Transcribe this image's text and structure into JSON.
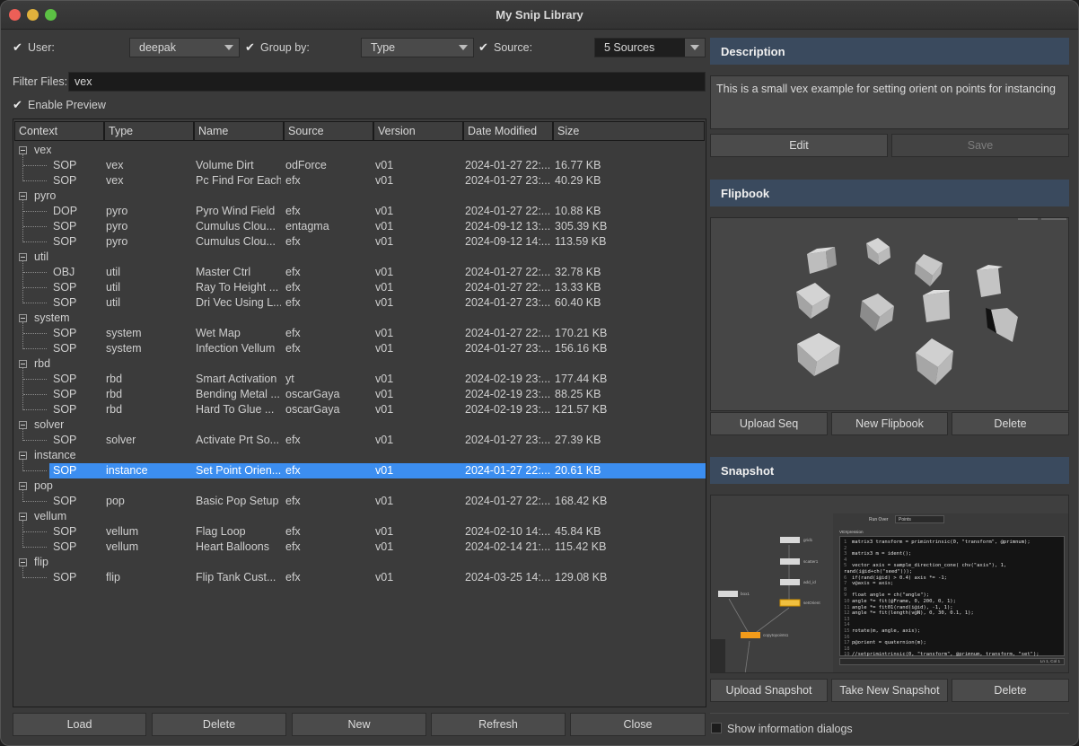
{
  "window": {
    "title": "My Snip Library"
  },
  "filters": {
    "user_label": "User:",
    "user_value": "deepak",
    "groupby_label": "Group by:",
    "groupby_value": "Type",
    "source_label": "Source:",
    "source_value": "5 Sources",
    "filter_label": "Filter Files:",
    "filter_value": "vex",
    "enable_preview_label": "Enable Preview"
  },
  "table": {
    "columns": [
      "Context",
      "Type",
      "Name",
      "Source",
      "Version",
      "Date Modified",
      "Size"
    ],
    "groups": [
      {
        "name": "vex",
        "rows": [
          [
            "SOP",
            "vex",
            "Volume Dirt",
            "odForce",
            "v01",
            "2024-01-27 22:...",
            "16.77 KB"
          ],
          [
            "SOP",
            "vex",
            "Pc Find For Each",
            "efx",
            "v01",
            "2024-01-27 23:...",
            "40.29 KB"
          ]
        ]
      },
      {
        "name": "pyro",
        "rows": [
          [
            "DOP",
            "pyro",
            "Pyro Wind Field",
            "efx",
            "v01",
            "2024-01-27 22:...",
            "10.88 KB"
          ],
          [
            "SOP",
            "pyro",
            "Cumulus Clou...",
            "entagma",
            "v01",
            "2024-09-12 13:...",
            "305.39 KB"
          ],
          [
            "SOP",
            "pyro",
            "Cumulus Clou...",
            "efx",
            "v01",
            "2024-09-12 14:...",
            "113.59 KB"
          ]
        ]
      },
      {
        "name": "util",
        "rows": [
          [
            "OBJ",
            "util",
            "Master Ctrl",
            "efx",
            "v01",
            "2024-01-27 22:...",
            "32.78 KB"
          ],
          [
            "SOP",
            "util",
            "Ray To Height ...",
            "efx",
            "v01",
            "2024-01-27 22:...",
            "13.33 KB"
          ],
          [
            "SOP",
            "util",
            "Dri Vec Using L...",
            "efx",
            "v01",
            "2024-01-27 23:...",
            "60.40 KB"
          ]
        ]
      },
      {
        "name": "system",
        "rows": [
          [
            "SOP",
            "system",
            "Wet Map",
            "efx",
            "v01",
            "2024-01-27 22:...",
            "170.21 KB"
          ],
          [
            "SOP",
            "system",
            "Infection Vellum",
            "efx",
            "v01",
            "2024-01-27 23:...",
            "156.16 KB"
          ]
        ]
      },
      {
        "name": "rbd",
        "rows": [
          [
            "SOP",
            "rbd",
            "Smart Activation",
            "yt",
            "v01",
            "2024-02-19 23:...",
            "177.44 KB"
          ],
          [
            "SOP",
            "rbd",
            "Bending Metal ...",
            "oscarGaya",
            "v01",
            "2024-02-19 23:...",
            "88.25 KB"
          ],
          [
            "SOP",
            "rbd",
            "Hard To Glue ...",
            "oscarGaya",
            "v01",
            "2024-02-19 23:...",
            "121.57 KB"
          ]
        ]
      },
      {
        "name": "solver",
        "rows": [
          [
            "SOP",
            "solver",
            "Activate Prt So...",
            "efx",
            "v01",
            "2024-01-27 23:...",
            "27.39 KB"
          ]
        ]
      },
      {
        "name": "instance",
        "rows": [
          [
            "SOP",
            "instance",
            "Set Point Orien...",
            "efx",
            "v01",
            "2024-01-27 22:...",
            "20.61 KB"
          ]
        ]
      },
      {
        "name": "pop",
        "rows": [
          [
            "SOP",
            "pop",
            "Basic Pop Setup",
            "efx",
            "v01",
            "2024-01-27 22:...",
            "168.42 KB"
          ]
        ]
      },
      {
        "name": "vellum",
        "rows": [
          [
            "SOP",
            "vellum",
            "Flag Loop",
            "efx",
            "v01",
            "2024-02-10 14:...",
            "45.84 KB"
          ],
          [
            "SOP",
            "vellum",
            "Heart Balloons",
            "efx",
            "v01",
            "2024-02-14 21:...",
            "115.42 KB"
          ]
        ]
      },
      {
        "name": "flip",
        "rows": [
          [
            "SOP",
            "flip",
            "Flip Tank Cust...",
            "efx",
            "v01",
            "2024-03-25 14:...",
            "129.08 KB"
          ]
        ]
      }
    ],
    "selected": "Set Point Orien..."
  },
  "bottom_buttons": {
    "load": "Load",
    "delete": "Delete",
    "new": "New",
    "refresh": "Refresh",
    "close": "Close"
  },
  "description": {
    "header": "Description",
    "text": "This is a small vex example for setting orient on points for instancing",
    "edit": "Edit",
    "save": "Save"
  },
  "flipbook": {
    "header": "Flipbook",
    "upload": "Upload Seq",
    "new": "New Flipbook",
    "delete": "Delete"
  },
  "snapshot": {
    "header": "Snapshot",
    "upload": "Upload Snapshot",
    "take": "Take New Snapshot",
    "delete": "Delete",
    "run_over_label": "Run Over",
    "run_over_value": "Points",
    "panel_title": "VEXpression",
    "cursor_status": "Ln 1, Col 1",
    "nodes": [
      "grid1",
      "scatter1",
      "add_id",
      "setOrient",
      "box1",
      "copytopoints1"
    ],
    "code": [
      "matrix3 transform = primintrinsic(0, \"transform\", @primnum);",
      "",
      "matrix3 m = ident();",
      "",
      "vector axis = sample_direction_cone( chv(\"axis\"), 1, rand(i@id+ch(\"seed\")));",
      "if(rand(i@id) > 0.4) axis *= -1;",
      "v@axis = axis;",
      "",
      "float angle = ch(\"angle\");",
      "angle *= fit(@Frame, 0, 200, 0, 1);",
      "angle *= fit01(rand(i@id), -1, 1);",
      "angle *= fit(length(v@N), 0, 30, 0.1, 1);",
      "",
      "",
      "rotate(m, angle, axis);",
      "",
      "p@orient = quaternion(m);",
      "",
      "//setprimintrinsic(0, \"transform\", @primnum, transform, \"set\");"
    ]
  },
  "footer": {
    "show_info": "Show information dialogs"
  }
}
